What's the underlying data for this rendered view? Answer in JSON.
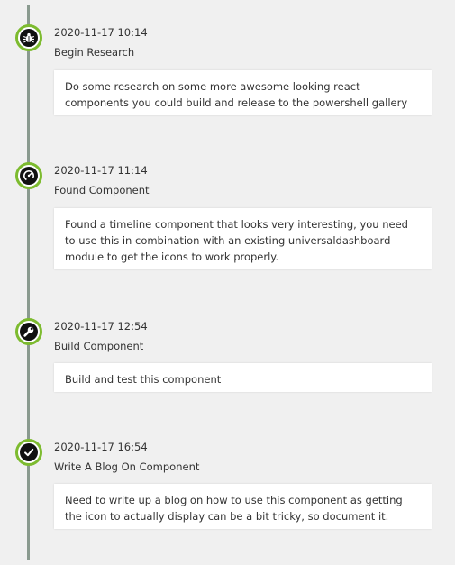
{
  "colors": {
    "accent": "#7dbb2f",
    "line": "#8a9a8f",
    "marker_fill": "#111111",
    "card_bg": "#ffffff",
    "page_bg": "#f0f0f0"
  },
  "entries": [
    {
      "timestamp": "2020-11-17 10:14",
      "title": "Begin Research",
      "body": "Do some research on some more awesome looking react components you could build and release to the powershell gallery",
      "icon": "bug-icon"
    },
    {
      "timestamp": "2020-11-17 11:14",
      "title": "Found Component",
      "body": "Found a timeline component that looks very interesting, you need to use this in combination with an existing universaldashboard module to get the icons to work properly.",
      "icon": "gauge-icon"
    },
    {
      "timestamp": "2020-11-17 12:54",
      "title": "Build Component",
      "body": "Build and test this component",
      "icon": "wrench-icon"
    },
    {
      "timestamp": "2020-11-17 16:54",
      "title": "Write A Blog On Component",
      "body": "Need to write up a blog on how to use this component as getting the icon to actually display can be a bit tricky, so document it.",
      "icon": "check-circle-icon"
    }
  ]
}
